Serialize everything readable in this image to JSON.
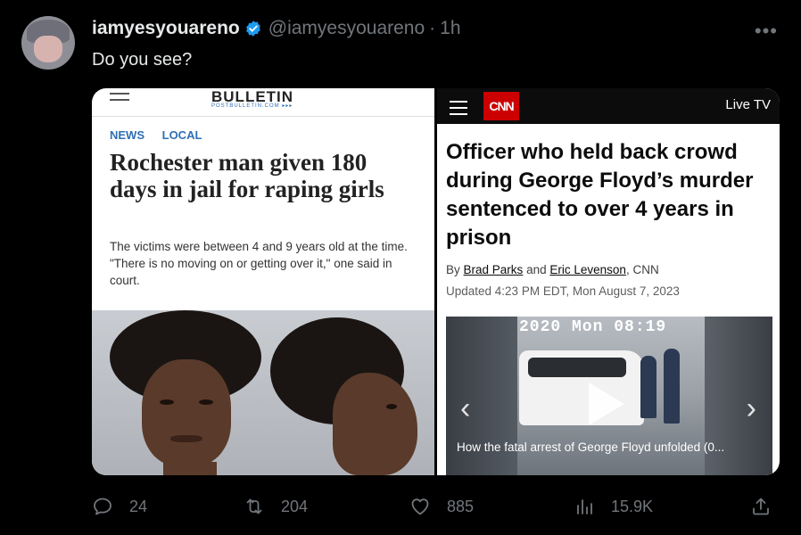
{
  "tweet": {
    "display_name": "iamyesyouareno",
    "handle": "@iamyesyouareno",
    "separator": "·",
    "time": "1h",
    "text": "Do you see?",
    "more": "•••"
  },
  "left_article": {
    "brand": "BULLETIN",
    "brand_sub": "POSTBULLETIN.COM ▸▸▸",
    "categories": [
      "NEWS",
      "LOCAL"
    ],
    "headline": "Rochester man given 180 days in jail for raping girls",
    "summary": "The victims were between 4 and 9 years old at the time. \"There is no moving on or getting over it,\" one said in court."
  },
  "right_article": {
    "logo": "CNN",
    "live_tv": "Live TV",
    "headline": "Officer who held back crowd during George Floyd’s murder sentenced to over 4 years in prison",
    "byline_prefix": "By",
    "author1": "Brad Parks",
    "byline_and": "and",
    "author2": "Eric Levenson",
    "byline_suffix": ", CNN",
    "updated": "Updated 4:23 PM EDT, Mon August 7, 2023",
    "video_timestamp": "2020 Mon 08:19",
    "video_caption": "How the fatal arrest of George Floyd unfolded (0..."
  },
  "actions": {
    "replies": "24",
    "reposts": "204",
    "likes": "885",
    "views": "15.9K"
  },
  "colors": {
    "background": "#000000",
    "text_primary": "#e7e9ea",
    "text_secondary": "#71767b",
    "verified_blue": "#1d9bf0",
    "cnn_red": "#cc0000",
    "bulletin_blue": "#2f6fb5"
  },
  "icons": [
    "verified-icon",
    "more-icon",
    "reply-icon",
    "repost-icon",
    "like-icon",
    "views-icon",
    "share-icon",
    "play-icon",
    "chevron-left-icon",
    "chevron-right-icon"
  ]
}
